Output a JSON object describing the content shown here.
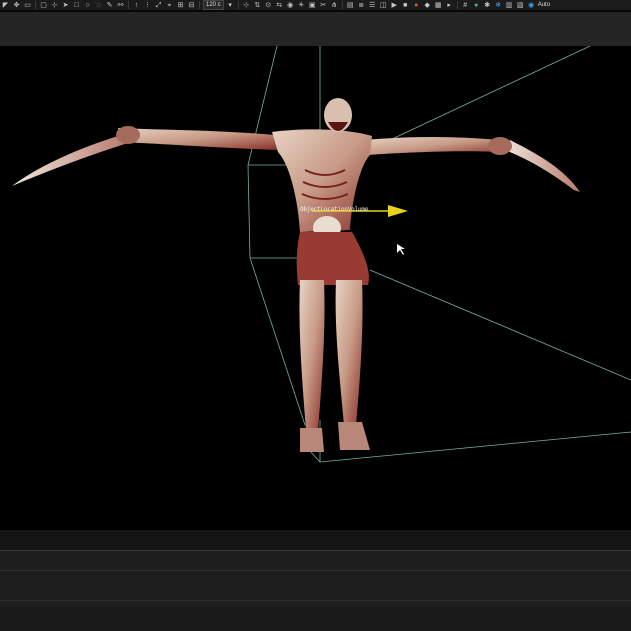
{
  "toolbar": {
    "icons": [
      "select-icon",
      "move-icon",
      "save-icon",
      "selection-rect-icon",
      "snap-icon",
      "pointer-icon",
      "rect-icon",
      "circle-icon",
      "lasso-icon",
      "paint-icon",
      "link-icon",
      "unlink-icon",
      "rotate-icon",
      "scale-icon",
      "frame-icon",
      "lock-icon",
      "bone-icon"
    ],
    "zoom_value": "120 c",
    "right_icons": [
      "camera-icon",
      "light-icon",
      "render-icon",
      "material-icon",
      "play-icon",
      "stop-icon",
      "grid-icon",
      "globe-icon",
      "settings-icon",
      "record-icon"
    ],
    "right_label": "Auto"
  },
  "viewport": {
    "object_label": "ObjectLocationVolume",
    "colors": {
      "background": "#000000",
      "frustum_line": "#8fd3b8",
      "gizmo_arrow": "#e6d21a"
    }
  }
}
